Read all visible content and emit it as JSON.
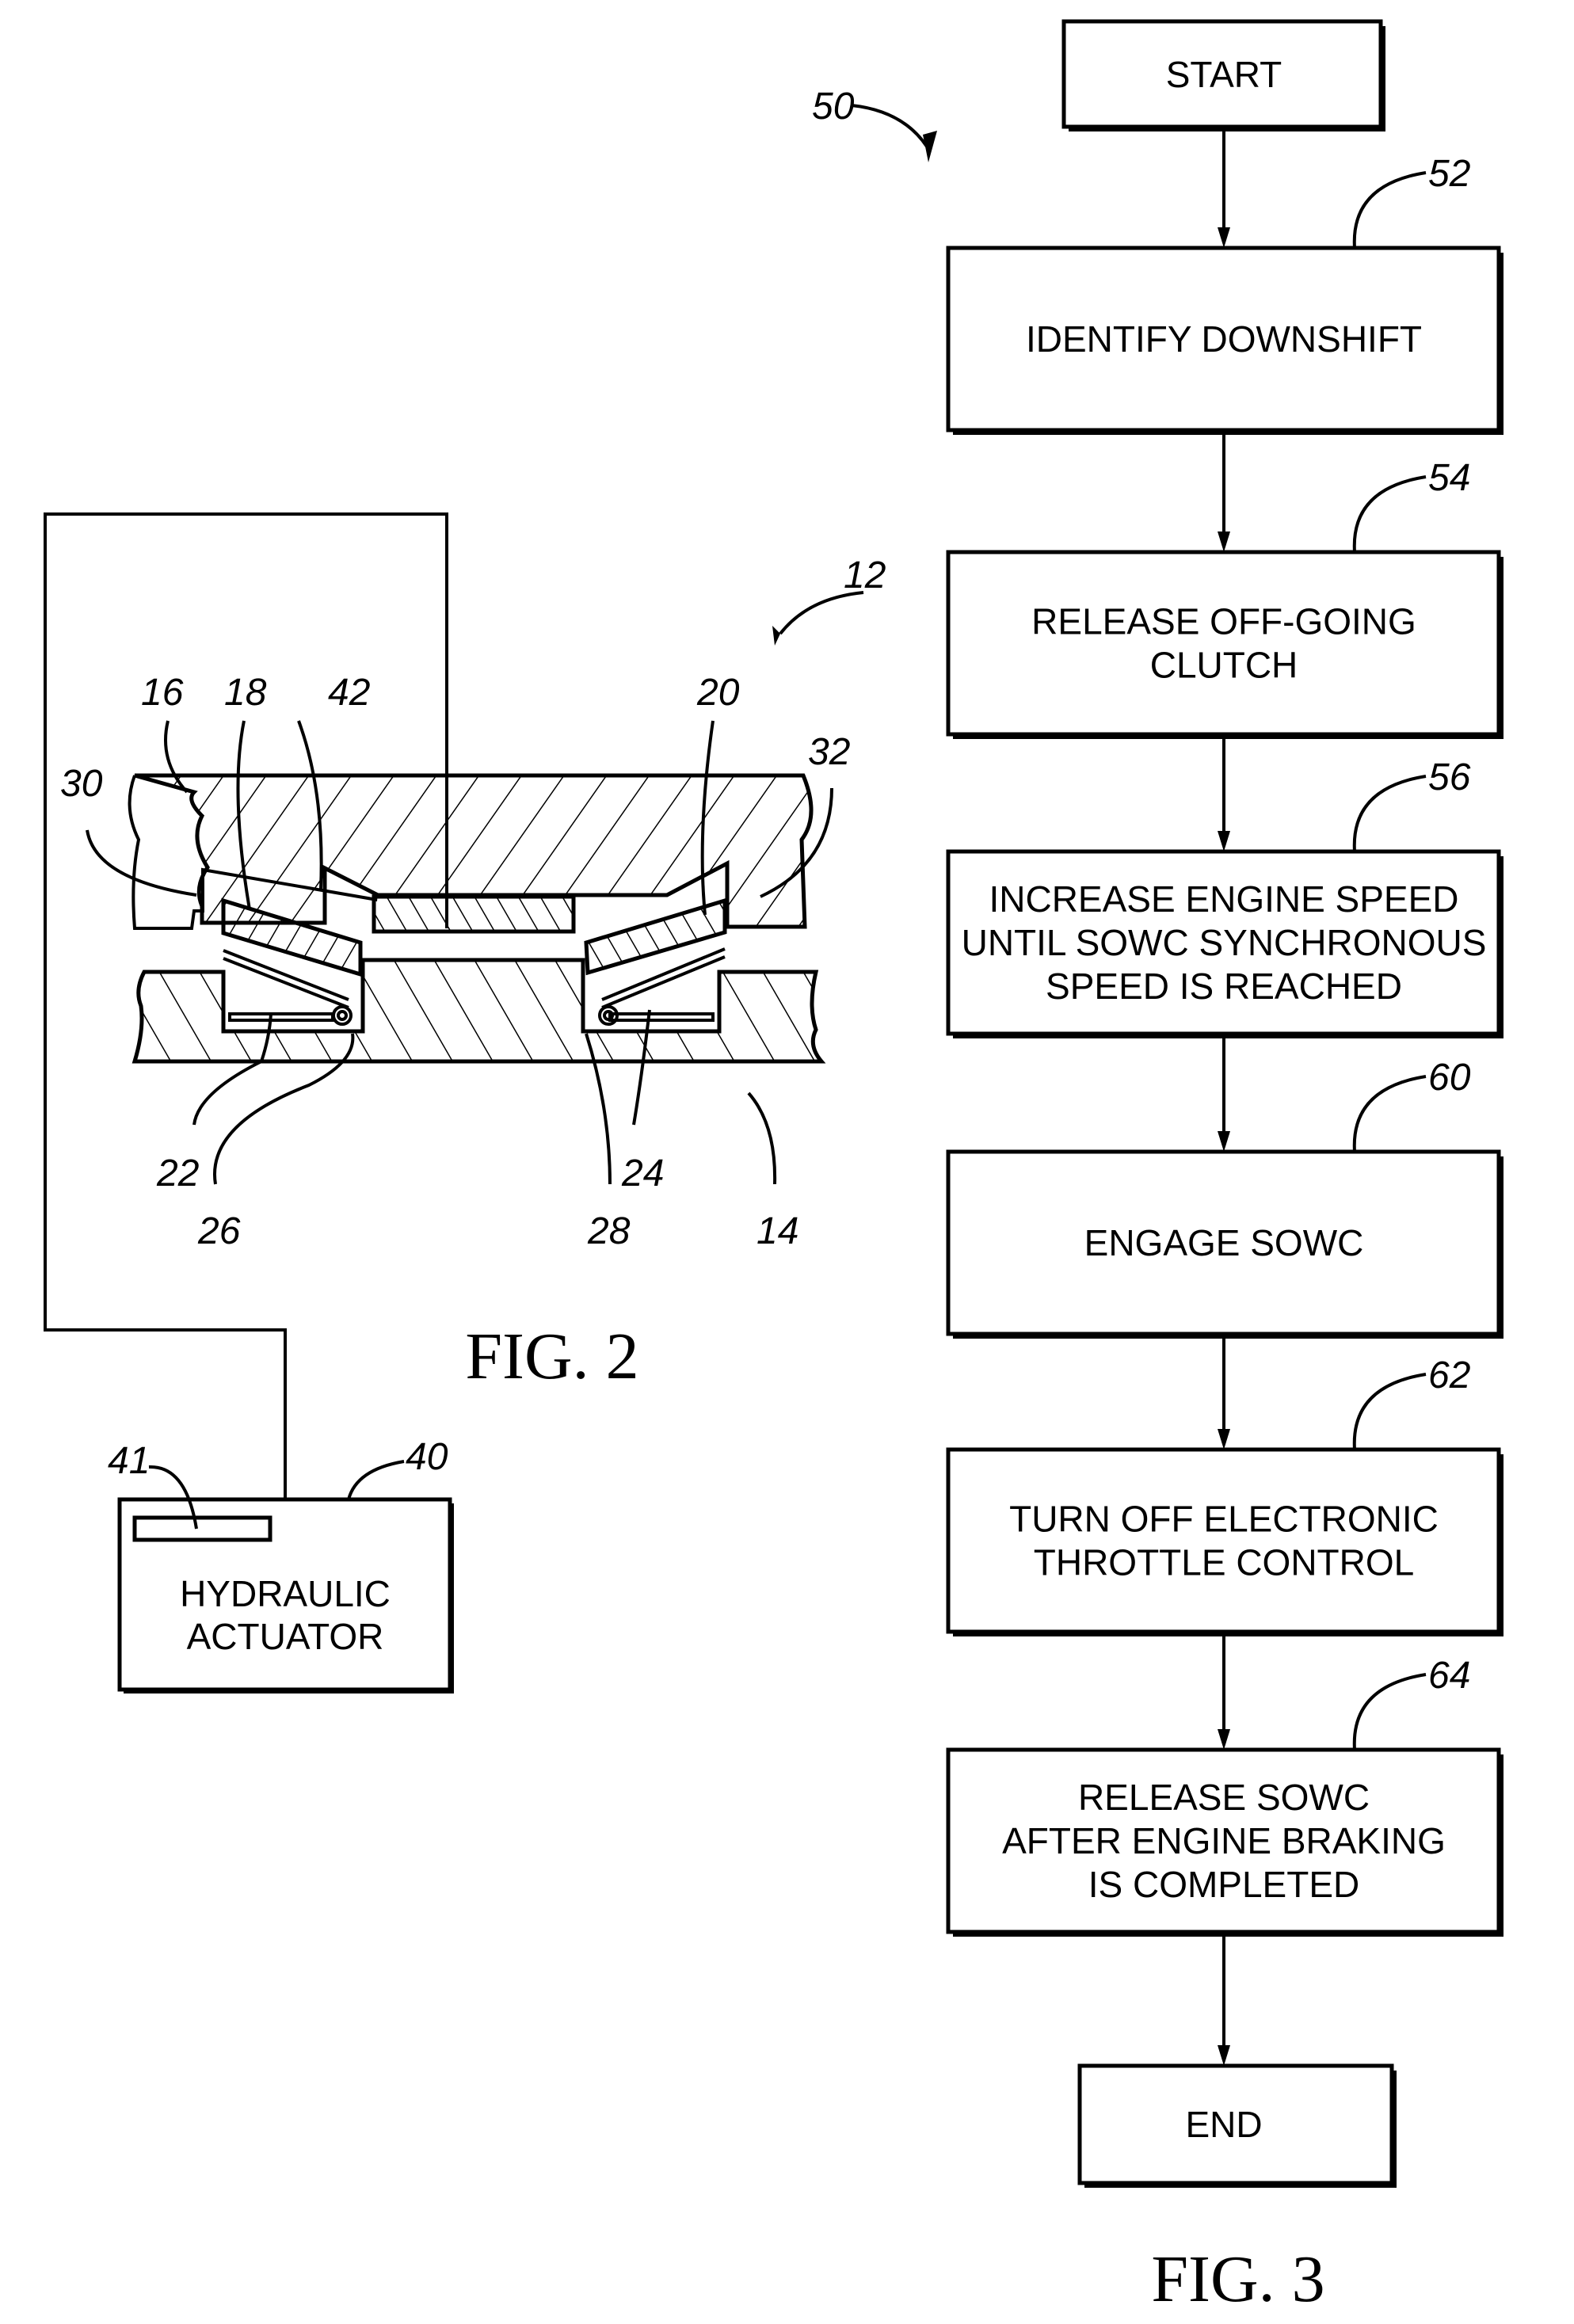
{
  "fig2": {
    "caption": "FIG. 2",
    "refs": {
      "r12": "12",
      "r16": "16",
      "r18": "18",
      "r42": "42",
      "r20": "20",
      "r30": "30",
      "r32": "32",
      "r22": "22",
      "r26": "26",
      "r28": "28",
      "r24": "24",
      "r14": "14",
      "r41": "41",
      "r40": "40"
    },
    "actuator": {
      "line1": "HYDRAULIC",
      "line2": "ACTUATOR"
    }
  },
  "fig3": {
    "caption": "FIG. 3",
    "ref_main": "50",
    "start": "START",
    "end": "END",
    "steps": [
      {
        "ref": "52",
        "lines": [
          "IDENTIFY DOWNSHIFT"
        ]
      },
      {
        "ref": "54",
        "lines": [
          "RELEASE OFF-GOING",
          "CLUTCH"
        ]
      },
      {
        "ref": "56",
        "lines": [
          "INCREASE ENGINE SPEED",
          "UNTIL SOWC SYNCHRONOUS",
          "SPEED IS REACHED"
        ]
      },
      {
        "ref": "60",
        "lines": [
          "ENGAGE SOWC"
        ]
      },
      {
        "ref": "62",
        "lines": [
          "TURN OFF  ELECTRONIC",
          "THROTTLE CONTROL"
        ]
      },
      {
        "ref": "64",
        "lines": [
          "RELEASE SOWC",
          "AFTER ENGINE BRAKING",
          "IS COMPLETED"
        ]
      }
    ]
  }
}
